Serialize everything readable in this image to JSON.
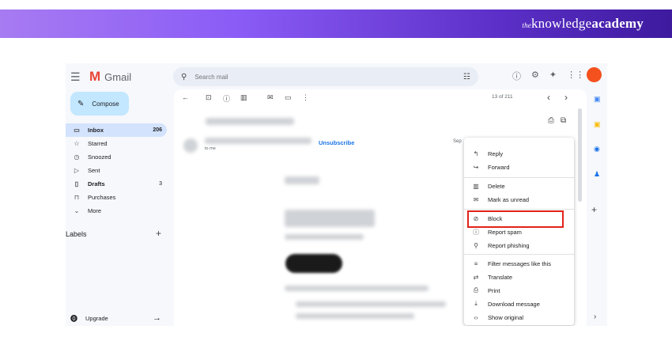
{
  "brand": {
    "prefix": "the",
    "middle": "knowledge",
    "suffix": "academy",
    "banner_color": "#8b5cf6"
  },
  "app": {
    "logo_letter": "M",
    "name": "Gmail",
    "accent": "#ea4335"
  },
  "search": {
    "placeholder": "Search mail"
  },
  "compose": {
    "label": "Compose"
  },
  "nav": [
    {
      "label": "Inbox",
      "count": "206",
      "icon": "inbox-icon"
    },
    {
      "label": "Starred",
      "count": "",
      "icon": "star-icon"
    },
    {
      "label": "Snoozed",
      "count": "",
      "icon": "clock-icon"
    },
    {
      "label": "Sent",
      "count": "",
      "icon": "send-icon"
    },
    {
      "label": "Drafts",
      "count": "3",
      "icon": "draft-icon"
    },
    {
      "label": "Purchases",
      "count": "",
      "icon": "purchases-icon"
    },
    {
      "label": "More",
      "count": "",
      "icon": "chevron-down-icon"
    }
  ],
  "labels_heading": "Labels",
  "upgrade": {
    "label": "Upgrade"
  },
  "pagination": "13 of 211",
  "message": {
    "to_me": "to me",
    "unsubscribe": "Unsubscribe",
    "date_partial": "Sep"
  },
  "menu": {
    "items": [
      {
        "label": "Reply",
        "icon": "reply-icon"
      },
      {
        "label": "Forward",
        "icon": "forward-icon"
      },
      {
        "label": "Delete",
        "icon": "trash-icon"
      },
      {
        "label": "Mark as unread",
        "icon": "mail-icon"
      },
      {
        "label": "Block",
        "icon": "block-icon"
      },
      {
        "label": "Report spam",
        "icon": "spam-icon"
      },
      {
        "label": "Report phishing",
        "icon": "phishing-icon"
      },
      {
        "label": "Filter messages like this",
        "icon": "filter-icon"
      },
      {
        "label": "Translate",
        "icon": "translate-icon"
      },
      {
        "label": "Print",
        "icon": "print-icon"
      },
      {
        "label": "Download message",
        "icon": "download-icon"
      },
      {
        "label": "Show original",
        "icon": "code-icon"
      }
    ],
    "highlight_color": "#e2231a"
  }
}
